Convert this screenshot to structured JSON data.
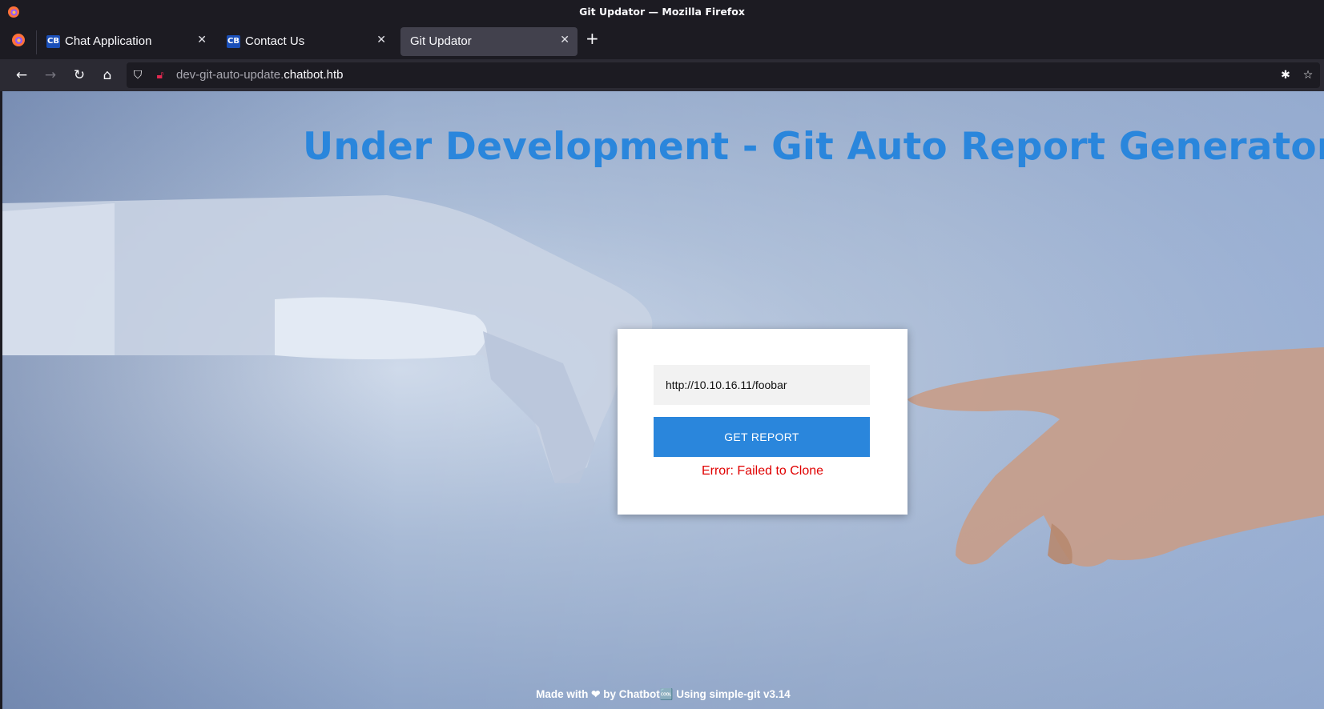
{
  "window": {
    "title": "Git Updator — Mozilla Firefox"
  },
  "tabs": [
    {
      "favicon": "CB",
      "label": "Chat Application"
    },
    {
      "favicon": "CB",
      "label": "Contact Us"
    },
    {
      "label": "Git Updator"
    }
  ],
  "address": {
    "prefix": "dev-git-auto-update.",
    "host": "chatbot.htb"
  },
  "page": {
    "headline": "Under Development - Git Auto Report Generator",
    "form": {
      "url_value": "http://10.10.16.11/foobar",
      "submit_label": "GET REPORT",
      "error": "Error: Failed to Clone"
    },
    "footer": "Made with ❤ by Chatbot🆒 Using simple-git v3.14"
  },
  "colors": {
    "accent": "#2a86dc",
    "error": "#e00000",
    "chrome": "#1c1b22"
  }
}
